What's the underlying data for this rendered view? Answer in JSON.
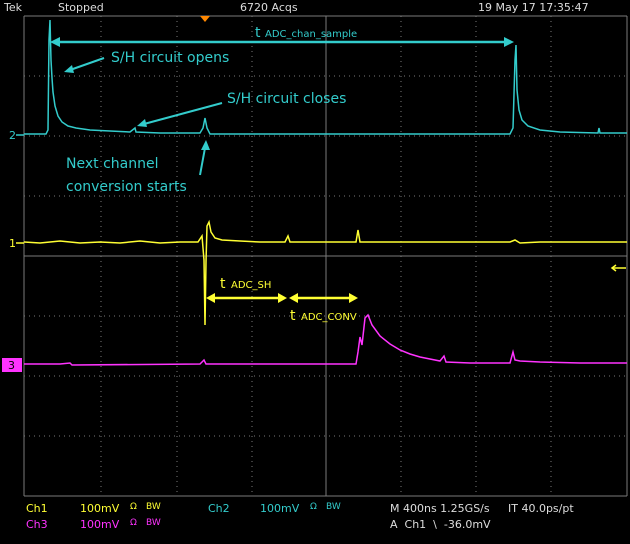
{
  "header": {
    "brand": "Tek",
    "state": "Stopped",
    "acqs": "6720 Acqs",
    "datetime": "19 May 17 17:35:47"
  },
  "markers": {
    "ch2": "2",
    "ch1": "1",
    "ch3": "3"
  },
  "annotations": {
    "t_sample_t": "t",
    "t_sample_sub": "ADC_chan_sample",
    "sh_opens": "S/H circuit opens",
    "sh_closes": "S/H circuit closes",
    "next_line1": "Next channel",
    "next_line2": "conversion starts",
    "t_sh_t": "t",
    "t_sh_sub": "ADC_SH",
    "t_conv_t": "t",
    "t_conv_sub": "ADC_CONV"
  },
  "footer": {
    "ch1_label": "Ch1",
    "ch1_scale": "100mV",
    "ch1_coupling": "Ω",
    "ch1_bw": "BW",
    "ch2_label": "Ch2",
    "ch2_scale": "100mV",
    "ch2_coupling": "Ω",
    "ch2_bw": "BW",
    "ch3_label": "Ch3",
    "ch3_scale": "100mV",
    "ch3_coupling": "Ω",
    "ch3_bw": "BW",
    "timebase": "M 400ns 1.25GS/s",
    "interp": "IT 40.0ps/pt",
    "trigger": "A  Ch1  \\  -36.0mV"
  },
  "colors": {
    "ch1": "#ffff33",
    "ch2": "#33cccc",
    "ch3": "#ff33ff",
    "grid": "#7a7a7a"
  }
}
